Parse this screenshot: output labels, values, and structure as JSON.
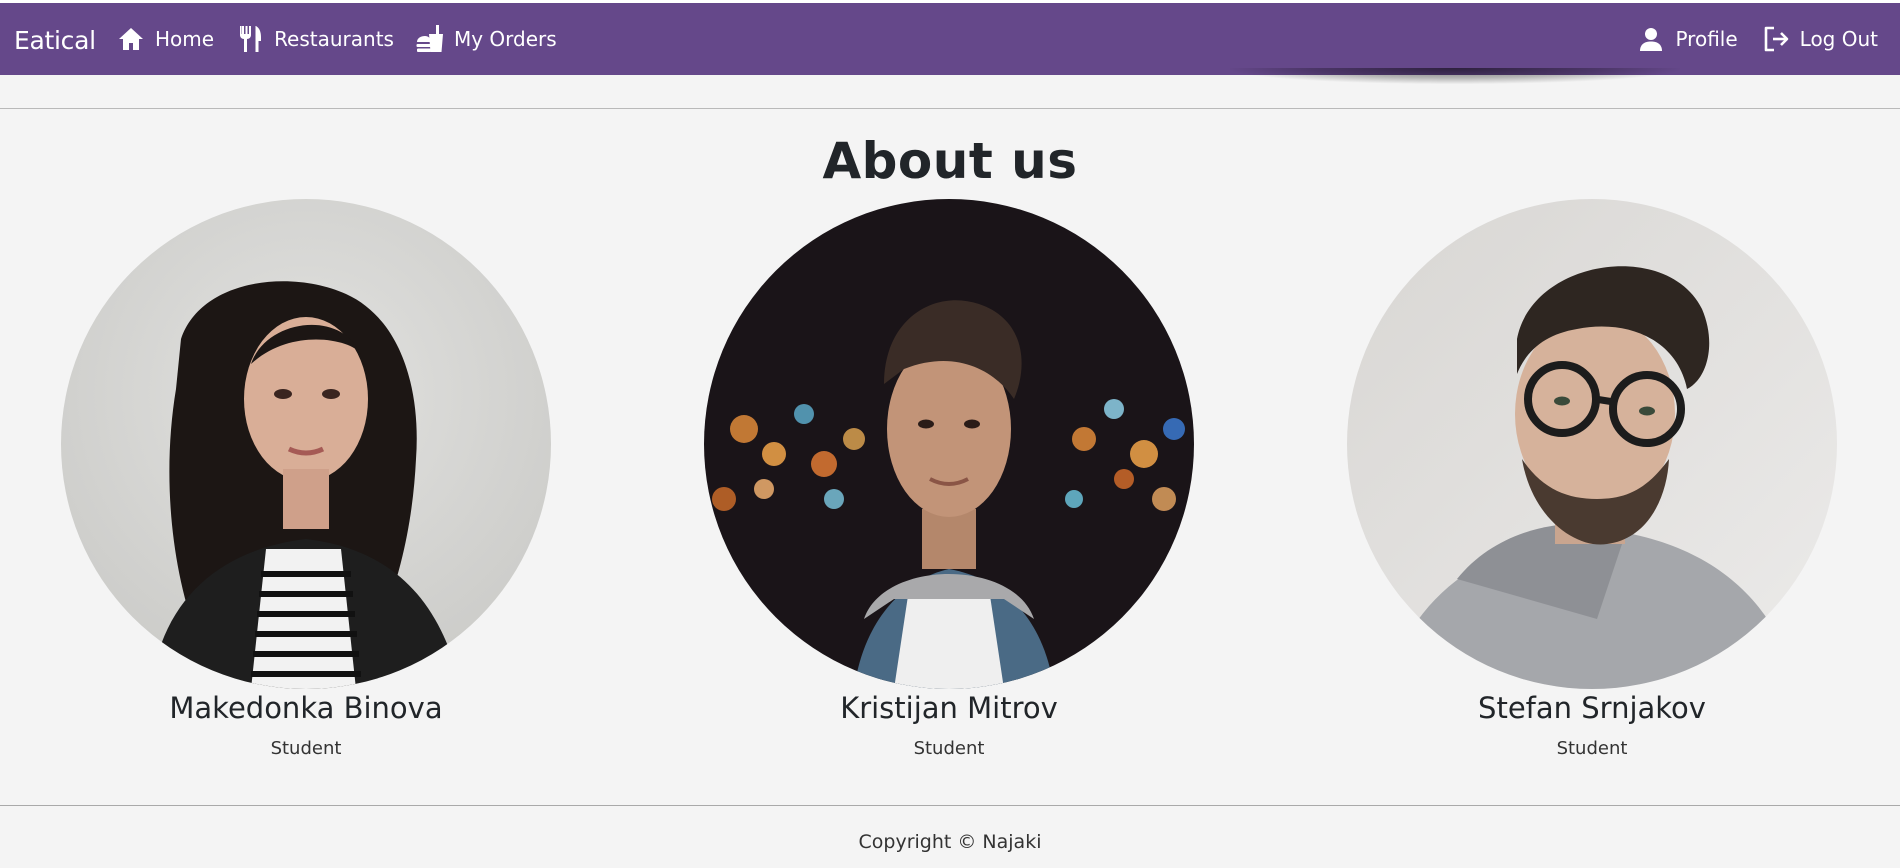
{
  "navbar": {
    "brand": "Eatical",
    "background_color": "#65488a",
    "left_items": [
      {
        "label": "Home",
        "icon": "home-icon"
      },
      {
        "label": "Restaurants",
        "icon": "fork-knife-icon"
      },
      {
        "label": "My Orders",
        "icon": "food-tray-icon"
      }
    ],
    "right_items": [
      {
        "label": "Profile",
        "icon": "user-icon"
      },
      {
        "label": "Log Out",
        "icon": "logout-icon"
      }
    ]
  },
  "main": {
    "title": "About us",
    "members": [
      {
        "name": "Makedonka Binova",
        "role": "Student",
        "photo": "portrait-woman-curly-hair"
      },
      {
        "name": "Kristijan Mitrov",
        "role": "Student",
        "photo": "portrait-man-night-bokeh"
      },
      {
        "name": "Stefan Srnjakov",
        "role": "Student",
        "photo": "portrait-man-glasses"
      }
    ]
  },
  "footer": {
    "copyright": "Copyright © Najaki"
  }
}
